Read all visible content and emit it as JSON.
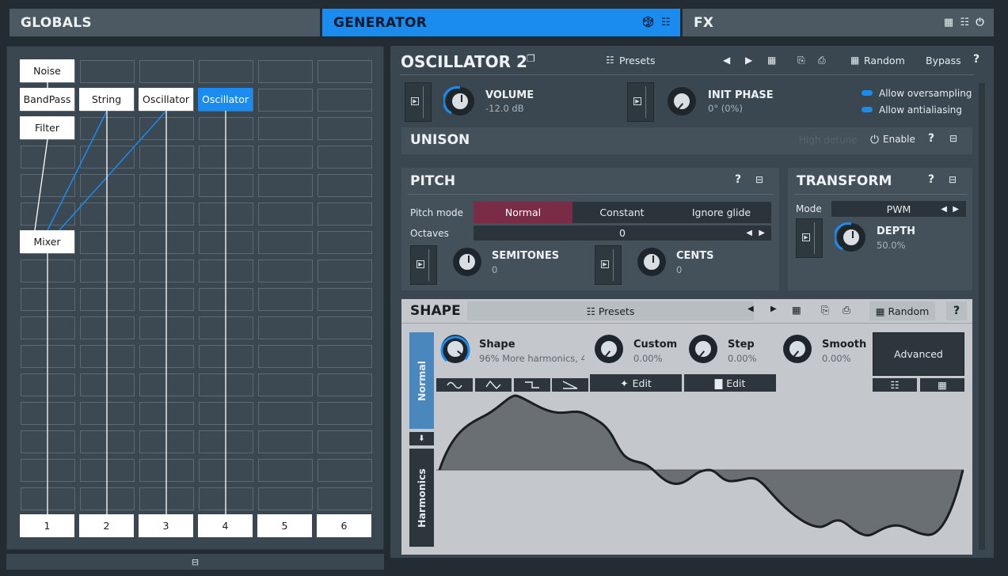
{
  "tabs": {
    "globals": "GLOBALS",
    "generator": "GENERATOR",
    "fx": "FX"
  },
  "routing": {
    "modules": {
      "noise": "Noise",
      "bandpass": "BandPass",
      "string": "String",
      "oscillator1": "Oscillator",
      "oscillator2": "Oscillator",
      "filter": "Filter",
      "mixer": "Mixer"
    },
    "columns": [
      "1",
      "2",
      "3",
      "4",
      "5",
      "6"
    ]
  },
  "oscillator": {
    "title": "OSCILLATOR 2",
    "presets_label": "Presets",
    "random_label": "Random",
    "bypass_label": "Bypass",
    "help": "?",
    "volume": {
      "label": "VOLUME",
      "value": "-12.0 dB"
    },
    "init_phase": {
      "label": "INIT PHASE",
      "value": "0° (0%)"
    },
    "allow_oversampling": "Allow oversampling",
    "allow_antialiasing": "Allow antialiasing"
  },
  "unison": {
    "title": "UNISON",
    "high_detune": "High detune",
    "enable": "Enable",
    "help": "?"
  },
  "pitch": {
    "title": "PITCH",
    "help": "?",
    "pitch_mode_label": "Pitch mode",
    "modes": [
      "Normal",
      "Constant",
      "Ignore glide"
    ],
    "octaves_label": "Octaves",
    "octaves_value": "0",
    "semitones": {
      "label": "SEMITONES",
      "value": "0"
    },
    "cents": {
      "label": "CENTS",
      "value": "0"
    }
  },
  "transform": {
    "title": "TRANSFORM",
    "help": "?",
    "mode_label": "Mode",
    "mode_value": "PWM",
    "depth": {
      "label": "DEPTH",
      "value": "50.0%"
    }
  },
  "shape": {
    "title": "SHAPE",
    "presets_label": "Presets",
    "random_label": "Random",
    "help": "?",
    "tab_normal": "Normal",
    "tab_harmonics": "Harmonics",
    "shape_knob": {
      "label": "Shape",
      "value": "96% More harmonics, 4"
    },
    "custom_knob": {
      "label": "Custom",
      "value": "0.00%"
    },
    "step_knob": {
      "label": "Step",
      "value": "0.00%"
    },
    "smooth_knob": {
      "label": "Smooth",
      "value": "0.00%"
    },
    "advanced_label": "Advanced",
    "edit_label_1": "Edit",
    "edit_label_2": "Edit"
  },
  "colors": {
    "accent": "#1a8cf0",
    "active_mode": "#7a2b45",
    "panel": "#3a4650"
  }
}
